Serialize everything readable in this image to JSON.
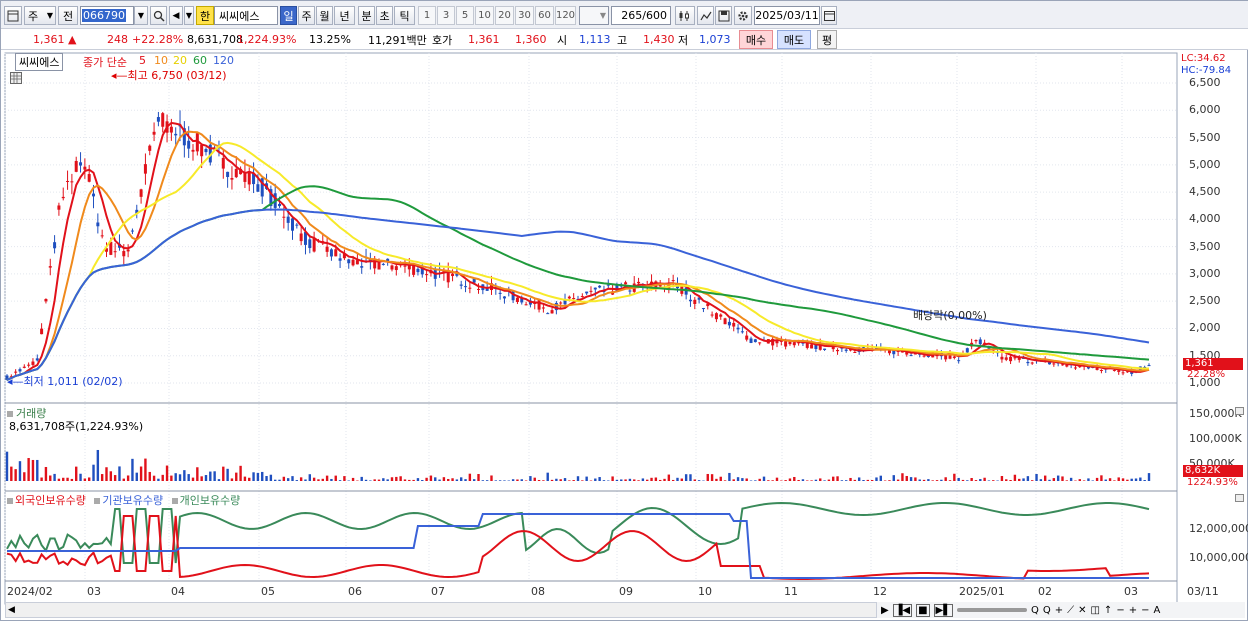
{
  "toolbar": {
    "market": "주",
    "prev": "전",
    "code": "066790",
    "hangul": "한",
    "name": "씨씨에스",
    "periods": [
      "일",
      "주",
      "월",
      "년",
      "분",
      "초",
      "틱"
    ],
    "intervals": [
      "1",
      "3",
      "5",
      "10",
      "20",
      "30",
      "60",
      "120"
    ],
    "count": "265",
    "count_total": "/600",
    "date": "2025/03/11"
  },
  "quote": {
    "price": "1,361",
    "arrow": "▲",
    "change": "248",
    "change_pct": "+22.28%",
    "volume": "8,631,708",
    "volume_pct": "1,224.93%",
    "turnover": "13.25%",
    "amount": "11,291백만",
    "hoga_label": "호가",
    "ask": "1,361",
    "bid": "1,360",
    "open_label": "시",
    "open": "1,113",
    "high_label": "고",
    "high": "1,430",
    "low_label": "저",
    "low": "1,073",
    "buy": "매수",
    "sell": "매도",
    "avg": "평"
  },
  "main": {
    "name_box": "씨씨에스",
    "ma_title": "종가 단순",
    "ma_periods": [
      "5",
      "10",
      "20",
      "60",
      "120"
    ],
    "max_label": "최고 6,750 (03/12)",
    "min_label": "최저 1,011 (02/02)",
    "event_label": "배당락(0,00%)",
    "lc": "LC:34.62",
    "hc": "HC:-79.84",
    "yticks": [
      "6,500",
      "6,000",
      "5,500",
      "5,000",
      "4,500",
      "4,000",
      "3,500",
      "3,000",
      "2,500",
      "2,000",
      "1,500",
      "1,000"
    ],
    "cur_price_tag": "1,361",
    "cur_pct_tag": "22.28%"
  },
  "volume_panel": {
    "title": "거래량",
    "current": "8,631,708주(1,224.93%)",
    "yticks": [
      "150,000K",
      "100,000K",
      "50,000K"
    ],
    "tag": "8,632K",
    "tag_pct": "1224.93%"
  },
  "holding_panel": {
    "series": [
      "외국인보유수량",
      "기관보유수량",
      "개인보유수량"
    ],
    "yticks": [
      "12,000,000",
      "10,000,000"
    ]
  },
  "xaxis": [
    "2024/02",
    "03",
    "04",
    "05",
    "06",
    "07",
    "08",
    "09",
    "10",
    "11",
    "12",
    "2025/01",
    "02",
    "03"
  ],
  "xaxis_right": "03/11",
  "colors": {
    "ma5": "#e1111a",
    "ma10": "#f08a1c",
    "ma20": "#f7ea2a",
    "ma60": "#1f9a3c",
    "ma120": "#3a62d8",
    "up": "#e1111a",
    "down": "#1f4fbf"
  }
}
